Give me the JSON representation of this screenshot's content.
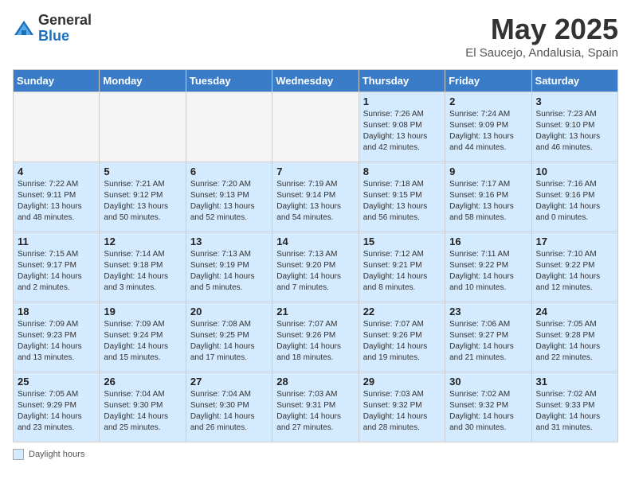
{
  "logo": {
    "general": "General",
    "blue": "Blue"
  },
  "title": "May 2025",
  "location": "El Saucejo, Andalusia, Spain",
  "days_of_week": [
    "Sunday",
    "Monday",
    "Tuesday",
    "Wednesday",
    "Thursday",
    "Friday",
    "Saturday"
  ],
  "footer_label": "Daylight hours",
  "weeks": [
    [
      {
        "day": "",
        "empty": true
      },
      {
        "day": "",
        "empty": true
      },
      {
        "day": "",
        "empty": true
      },
      {
        "day": "",
        "empty": true
      },
      {
        "day": "1",
        "sunrise": "7:26 AM",
        "sunset": "9:08 PM",
        "daylight": "13 hours and 42 minutes."
      },
      {
        "day": "2",
        "sunrise": "7:24 AM",
        "sunset": "9:09 PM",
        "daylight": "13 hours and 44 minutes."
      },
      {
        "day": "3",
        "sunrise": "7:23 AM",
        "sunset": "9:10 PM",
        "daylight": "13 hours and 46 minutes."
      }
    ],
    [
      {
        "day": "4",
        "sunrise": "7:22 AM",
        "sunset": "9:11 PM",
        "daylight": "13 hours and 48 minutes."
      },
      {
        "day": "5",
        "sunrise": "7:21 AM",
        "sunset": "9:12 PM",
        "daylight": "13 hours and 50 minutes."
      },
      {
        "day": "6",
        "sunrise": "7:20 AM",
        "sunset": "9:13 PM",
        "daylight": "13 hours and 52 minutes."
      },
      {
        "day": "7",
        "sunrise": "7:19 AM",
        "sunset": "9:14 PM",
        "daylight": "13 hours and 54 minutes."
      },
      {
        "day": "8",
        "sunrise": "7:18 AM",
        "sunset": "9:15 PM",
        "daylight": "13 hours and 56 minutes."
      },
      {
        "day": "9",
        "sunrise": "7:17 AM",
        "sunset": "9:16 PM",
        "daylight": "13 hours and 58 minutes."
      },
      {
        "day": "10",
        "sunrise": "7:16 AM",
        "sunset": "9:16 PM",
        "daylight": "14 hours and 0 minutes."
      }
    ],
    [
      {
        "day": "11",
        "sunrise": "7:15 AM",
        "sunset": "9:17 PM",
        "daylight": "14 hours and 2 minutes."
      },
      {
        "day": "12",
        "sunrise": "7:14 AM",
        "sunset": "9:18 PM",
        "daylight": "14 hours and 3 minutes."
      },
      {
        "day": "13",
        "sunrise": "7:13 AM",
        "sunset": "9:19 PM",
        "daylight": "14 hours and 5 minutes."
      },
      {
        "day": "14",
        "sunrise": "7:13 AM",
        "sunset": "9:20 PM",
        "daylight": "14 hours and 7 minutes."
      },
      {
        "day": "15",
        "sunrise": "7:12 AM",
        "sunset": "9:21 PM",
        "daylight": "14 hours and 8 minutes."
      },
      {
        "day": "16",
        "sunrise": "7:11 AM",
        "sunset": "9:22 PM",
        "daylight": "14 hours and 10 minutes."
      },
      {
        "day": "17",
        "sunrise": "7:10 AM",
        "sunset": "9:22 PM",
        "daylight": "14 hours and 12 minutes."
      }
    ],
    [
      {
        "day": "18",
        "sunrise": "7:09 AM",
        "sunset": "9:23 PM",
        "daylight": "14 hours and 13 minutes."
      },
      {
        "day": "19",
        "sunrise": "7:09 AM",
        "sunset": "9:24 PM",
        "daylight": "14 hours and 15 minutes."
      },
      {
        "day": "20",
        "sunrise": "7:08 AM",
        "sunset": "9:25 PM",
        "daylight": "14 hours and 17 minutes."
      },
      {
        "day": "21",
        "sunrise": "7:07 AM",
        "sunset": "9:26 PM",
        "daylight": "14 hours and 18 minutes."
      },
      {
        "day": "22",
        "sunrise": "7:07 AM",
        "sunset": "9:26 PM",
        "daylight": "14 hours and 19 minutes."
      },
      {
        "day": "23",
        "sunrise": "7:06 AM",
        "sunset": "9:27 PM",
        "daylight": "14 hours and 21 minutes."
      },
      {
        "day": "24",
        "sunrise": "7:05 AM",
        "sunset": "9:28 PM",
        "daylight": "14 hours and 22 minutes."
      }
    ],
    [
      {
        "day": "25",
        "sunrise": "7:05 AM",
        "sunset": "9:29 PM",
        "daylight": "14 hours and 23 minutes."
      },
      {
        "day": "26",
        "sunrise": "7:04 AM",
        "sunset": "9:30 PM",
        "daylight": "14 hours and 25 minutes."
      },
      {
        "day": "27",
        "sunrise": "7:04 AM",
        "sunset": "9:30 PM",
        "daylight": "14 hours and 26 minutes."
      },
      {
        "day": "28",
        "sunrise": "7:03 AM",
        "sunset": "9:31 PM",
        "daylight": "14 hours and 27 minutes."
      },
      {
        "day": "29",
        "sunrise": "7:03 AM",
        "sunset": "9:32 PM",
        "daylight": "14 hours and 28 minutes."
      },
      {
        "day": "30",
        "sunrise": "7:02 AM",
        "sunset": "9:32 PM",
        "daylight": "14 hours and 30 minutes."
      },
      {
        "day": "31",
        "sunrise": "7:02 AM",
        "sunset": "9:33 PM",
        "daylight": "14 hours and 31 minutes."
      }
    ]
  ]
}
